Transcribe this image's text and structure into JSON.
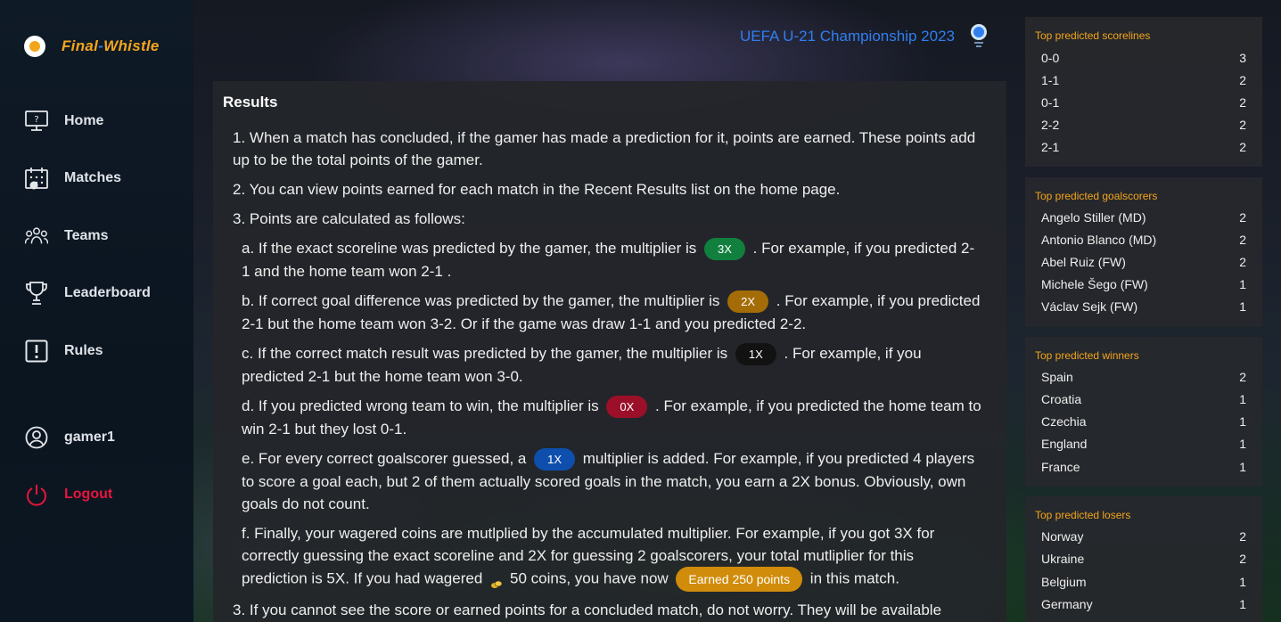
{
  "sidebar": {
    "brand": {
      "part1": "Final",
      "sep": "-",
      "part2": "Whistle"
    },
    "nav": [
      {
        "label": "Home",
        "icon": "monitor-question-icon"
      },
      {
        "label": "Matches",
        "icon": "calendar-icon"
      },
      {
        "label": "Teams",
        "icon": "people-icon"
      },
      {
        "label": "Leaderboard",
        "icon": "trophy-icon"
      },
      {
        "label": "Rules",
        "icon": "exclamation-box-icon"
      }
    ],
    "user": {
      "label": "gamer1",
      "icon": "user-circle-icon"
    },
    "logout": {
      "label": "Logout",
      "icon": "power-icon"
    }
  },
  "header": {
    "title": "UEFA U-21 Championship 2023"
  },
  "results": {
    "title": "Results",
    "r1": "1. When a match has concluded, if the gamer has made a prediction for it, points are earned. These points add up to be the total points of the gamer.",
    "r2": "2. You can view points earned for each match in the Recent Results list on the home page.",
    "r3": "3. Points are calculated as follows:",
    "a_pre": "a. If the exact scoreline was predicted by the gamer, the multiplier is",
    "a_badge": "3X",
    "a_post": ". For example, if you predicted 2-1 and the home team won 2-1 .",
    "b_pre": "b. If correct goal difference was predicted by the gamer, the multiplier is",
    "b_badge": "2X",
    "b_post": ". For example, if you predicted 2-1 but the home team won 3-2. Or if the game was draw 1-1 and you predicted 2-2.",
    "c_pre": "c. If the correct match result was predicted by the gamer, the multiplier is",
    "c_badge": "1X",
    "c_post": ". For example, if you predicted 2-1 but the home team won 3-0.",
    "d_pre": "d. If you predicted wrong team to win, the multiplier is",
    "d_badge": "0X",
    "d_post": ". For example, if you predicted the home team to win 2-1 but they lost 0-1.",
    "e_pre": "e. For every correct goalscorer guessed, a",
    "e_badge": "1X",
    "e_post": "multiplier is added. For example, if you predicted 4 players to score a goal each, but 2 of them actually scored goals in the match, you earn a 2X bonus. Obviously, own goals do not count.",
    "f_pre": "f. Finally, your wagered coins are mutlplied by the accumulated multiplier. For example, if you got 3X for correctly guessing the exact scoreline and 2X for guessing 2 goalscorers, your total mutliplier for this prediction is 5X. If you had wagered",
    "f_coins": "50 coins, you have now",
    "f_earned": "Earned 250 points",
    "f_post": "in this match.",
    "r4": "3. If you cannot see the score or earned points for a concluded match, do not worry. They will be available"
  },
  "panels": [
    {
      "title": "Top predicted scorelines",
      "rows": [
        {
          "label": "0-0",
          "count": "3"
        },
        {
          "label": "1-1",
          "count": "2"
        },
        {
          "label": "0-1",
          "count": "2"
        },
        {
          "label": "2-2",
          "count": "2"
        },
        {
          "label": "2-1",
          "count": "2"
        }
      ]
    },
    {
      "title": "Top predicted goalscorers",
      "rows": [
        {
          "label": "Angelo Stiller (MD)",
          "count": "2"
        },
        {
          "label": "Antonio Blanco (MD)",
          "count": "2"
        },
        {
          "label": "Abel Ruiz (FW)",
          "count": "2"
        },
        {
          "label": "Michele Šego (FW)",
          "count": "1"
        },
        {
          "label": "Václav Sejk (FW)",
          "count": "1"
        }
      ]
    },
    {
      "title": "Top predicted winners",
      "rows": [
        {
          "label": "Spain",
          "count": "2"
        },
        {
          "label": "Croatia",
          "count": "1"
        },
        {
          "label": "Czechia",
          "count": "1"
        },
        {
          "label": "England",
          "count": "1"
        },
        {
          "label": "France",
          "count": "1"
        }
      ]
    },
    {
      "title": "Top predicted losers",
      "rows": [
        {
          "label": "Norway",
          "count": "2"
        },
        {
          "label": "Ukraine",
          "count": "2"
        },
        {
          "label": "Belgium",
          "count": "1"
        },
        {
          "label": "Germany",
          "count": "1"
        }
      ]
    }
  ]
}
